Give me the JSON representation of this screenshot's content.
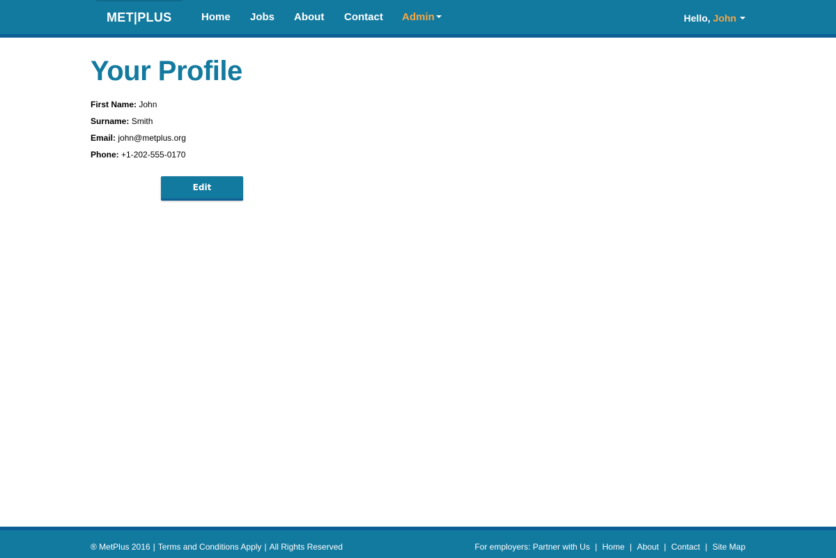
{
  "header": {
    "brand": "MET|PLUS",
    "nav": {
      "home": "Home",
      "jobs": "Jobs",
      "about": "About",
      "contact": "Contact",
      "admin": "Admin"
    },
    "greeting": "Hello,",
    "user_name": "John",
    "colors": {
      "bar": "#12799f",
      "accent": "#f3a847"
    }
  },
  "main": {
    "title": "Your Profile",
    "fields": [
      {
        "label": "First Name:",
        "value": "John"
      },
      {
        "label": "Surname:",
        "value": "Smith"
      },
      {
        "label": "Email:",
        "value": "john@metplus.org"
      },
      {
        "label": "Phone:",
        "value": "+1-202-555-0170"
      }
    ],
    "edit_label": "Edit"
  },
  "footer": {
    "copyright": "® MetPlus 2016",
    "terms": "Terms and Conditions Apply",
    "rights": "All Rights Reserved",
    "employers_prefix": "For employers:",
    "partner": "Partner with Us",
    "home": "Home",
    "about": "About",
    "contact": "Contact",
    "sitemap": "Site Map"
  }
}
